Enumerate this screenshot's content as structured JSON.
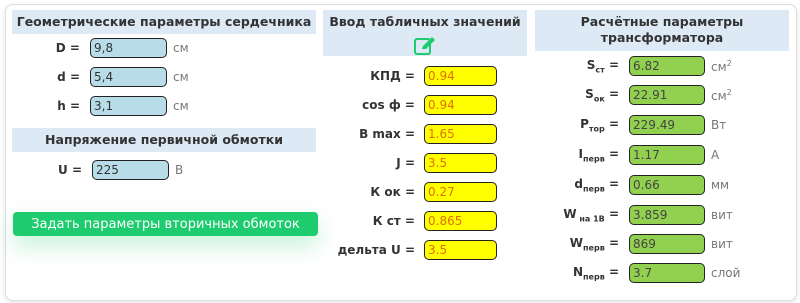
{
  "core": {
    "title": "Геометрические параметры сердечника",
    "fields": [
      {
        "label": "D =",
        "value": "9,8",
        "unit": "см"
      },
      {
        "label": "d =",
        "value": "5,4",
        "unit": "см"
      },
      {
        "label": "h =",
        "value": "3,1",
        "unit": "см"
      }
    ]
  },
  "primary": {
    "title": "Напряжение первичной обмотки",
    "label": "U =",
    "value": "225",
    "unit": "В"
  },
  "secondary_button": "Задать параметры вторичных обмоток",
  "table": {
    "title": "Ввод табличных значений",
    "icon": "edit-icon",
    "fields": [
      {
        "label": "КПД =",
        "value": "0.94"
      },
      {
        "label": "cos ф =",
        "value": "0.94"
      },
      {
        "label": "B max =",
        "value": "1.65"
      },
      {
        "label": "J =",
        "value": "3.5"
      },
      {
        "label": "К ок =",
        "value": "0.27"
      },
      {
        "label": "К ст =",
        "value": "0.865"
      },
      {
        "label": "дельта U =",
        "value": "3.5"
      }
    ]
  },
  "calc": {
    "title_line1": "Расчётные параметры",
    "title_line2": "трансформатора",
    "fields": [
      {
        "main": "S",
        "sub": "ст",
        "eq": " =",
        "value": "6.82",
        "unit": "см",
        "unit_sup": "2"
      },
      {
        "main": "S",
        "sub": "ок",
        "eq": " =",
        "value": "22.91",
        "unit": "см",
        "unit_sup": "2"
      },
      {
        "main": "P",
        "sub": "тор",
        "eq": " =",
        "value": "229.49",
        "unit": "Вт",
        "unit_sup": ""
      },
      {
        "main": "I",
        "sub": "перв",
        "eq": " =",
        "value": "1.17",
        "unit": "А",
        "unit_sup": ""
      },
      {
        "main": "d",
        "sub": "перв",
        "eq": " =",
        "value": "0.66",
        "unit": "мм",
        "unit_sup": ""
      },
      {
        "main": "W",
        "sub": " на 1В",
        "eq": " =",
        "value": "3.859",
        "unit": "вит",
        "unit_sup": ""
      },
      {
        "main": "W",
        "sub": "перв",
        "eq": " =",
        "value": "869",
        "unit": "вит",
        "unit_sup": ""
      },
      {
        "main": "N",
        "sub": "перв",
        "eq": " =",
        "value": "3.7",
        "unit": "слой",
        "unit_sup": ""
      }
    ]
  },
  "colors": {
    "header_bg": "#dde9f5",
    "input_blue": "#b8dde9",
    "input_yellow": "#ffff00",
    "input_green": "#92d050",
    "button": "#1ecb6e"
  }
}
